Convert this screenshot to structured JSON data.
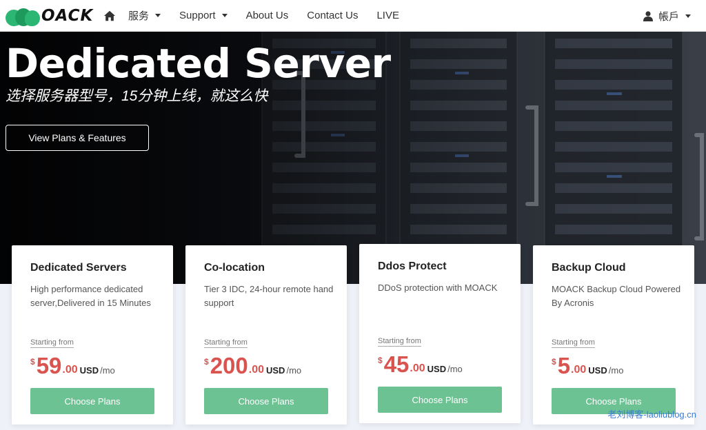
{
  "nav": {
    "logo_text": "OACK",
    "items": [
      {
        "label": "服务",
        "dropdown": true
      },
      {
        "label": "Support",
        "dropdown": true
      },
      {
        "label": "About Us",
        "dropdown": false
      },
      {
        "label": "Contact Us",
        "dropdown": false
      },
      {
        "label": "LIVE",
        "dropdown": false
      }
    ],
    "account_label": "帳戶"
  },
  "hero": {
    "title": "Dedicated Server",
    "subtitle": "选择服务器型号，15分钟上线，就这么快",
    "button_label": "View Plans & Features"
  },
  "cards": [
    {
      "title": "Dedicated Servers",
      "desc": "High performance dedicated server,Delivered in 15 Minutes",
      "starting": "Starting from",
      "currency": "$",
      "price_int": "59",
      "price_dec": ".00",
      "unit": "USD",
      "period": "/mo",
      "button": "Choose Plans"
    },
    {
      "title": "Co-location",
      "desc": "Tier 3 IDC, 24-hour remote hand support",
      "starting": "Starting from",
      "currency": "$",
      "price_int": "200",
      "price_dec": ".00",
      "unit": "USD",
      "period": "/mo",
      "button": "Choose Plans"
    },
    {
      "title": "Ddos Protect",
      "desc": "DDoS protection with MOACK",
      "starting": "Starting from",
      "currency": "$",
      "price_int": "45",
      "price_dec": ".00",
      "unit": "USD",
      "period": "/mo",
      "button": "Choose Plans"
    },
    {
      "title": "Backup Cloud",
      "desc": "MOACK Backup Cloud Powered By Acronis",
      "starting": "Starting from",
      "currency": "$",
      "price_int": "5",
      "price_dec": ".00",
      "unit": "USD",
      "period": "/mo",
      "button": "Choose Plans"
    }
  ],
  "watermark": "老刘博客-laoliublog.cn",
  "colors": {
    "accent_green": "#6cc292",
    "price_red": "#d9534f",
    "logo_green": "#2bb673"
  },
  "icons": {
    "home": "home-icon",
    "user": "user-icon",
    "dropdown": "caret-down-icon"
  }
}
